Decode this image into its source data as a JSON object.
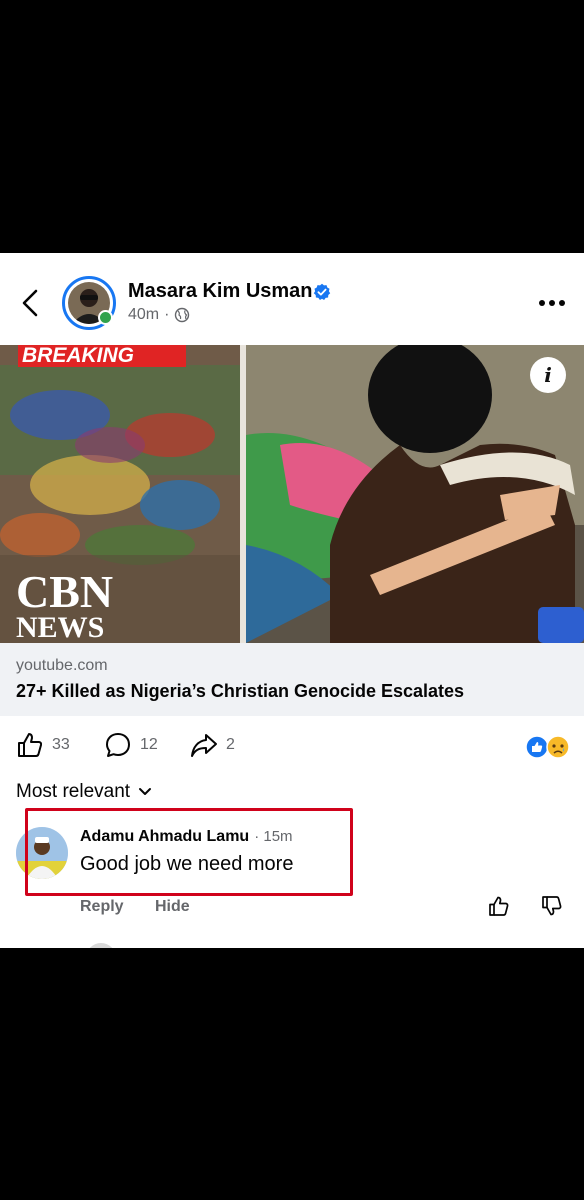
{
  "post": {
    "author": "Masara Kim Usman",
    "time": "40m",
    "separator": "·",
    "privacy_icon": "globe-icon",
    "verified_icon": "verified-badge-icon"
  },
  "media": {
    "left_image": {
      "banner_text": "BREAKING",
      "logo_line1": "CBN",
      "logo_line2": "NEWS"
    },
    "info_icon_label": "i"
  },
  "link": {
    "domain": "youtube.com",
    "title": "27+ Killed as Nigeria’s Christian Genocide Escalates"
  },
  "actions": {
    "likes": "33",
    "comments": "12",
    "shares": "2",
    "reaction_icons": [
      "like-reaction-icon",
      "sad-reaction-icon"
    ]
  },
  "comments_sort": {
    "label": "Most relevant"
  },
  "comment": {
    "author": "Adamu Ahmadu Lamu",
    "time": "· 15m",
    "text": "Good job we need more",
    "reply_label": "Reply",
    "hide_label": "Hide",
    "highlight_color": "#d0021b"
  },
  "colors": {
    "accent": "#1877f2",
    "online": "#31a24c",
    "secondary_text": "#65676b"
  }
}
